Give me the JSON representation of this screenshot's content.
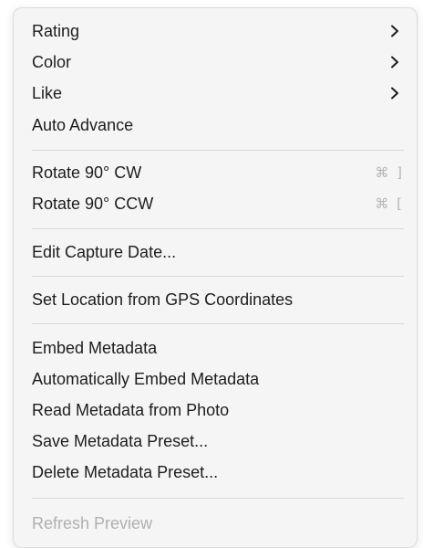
{
  "menu": {
    "items": [
      {
        "label": "Rating",
        "submenu_icon": "chevron-right-icon"
      },
      {
        "label": "Color",
        "submenu_icon": "chevron-right-icon"
      },
      {
        "label": "Like",
        "submenu_icon": "chevron-right-icon"
      },
      {
        "label": "Auto Advance"
      },
      {
        "label": "Rotate 90° CW",
        "shortcut": "⌘ ]"
      },
      {
        "label": "Rotate 90° CCW",
        "shortcut": "⌘ ["
      },
      {
        "label": "Edit Capture Date..."
      },
      {
        "label": "Set Location from GPS Coordinates"
      },
      {
        "label": "Embed Metadata"
      },
      {
        "label": "Automatically Embed Metadata"
      },
      {
        "label": "Read Metadata from Photo"
      },
      {
        "label": "Save Metadata Preset..."
      },
      {
        "label": "Delete Metadata Preset..."
      },
      {
        "label": "Refresh Preview",
        "state": "disabled"
      }
    ]
  },
  "colors": {
    "menu_background": "#f5f5f5",
    "text": "#1d1d1d",
    "disabled_text": "#b0b0b0",
    "separator": "#d8d8d8"
  }
}
